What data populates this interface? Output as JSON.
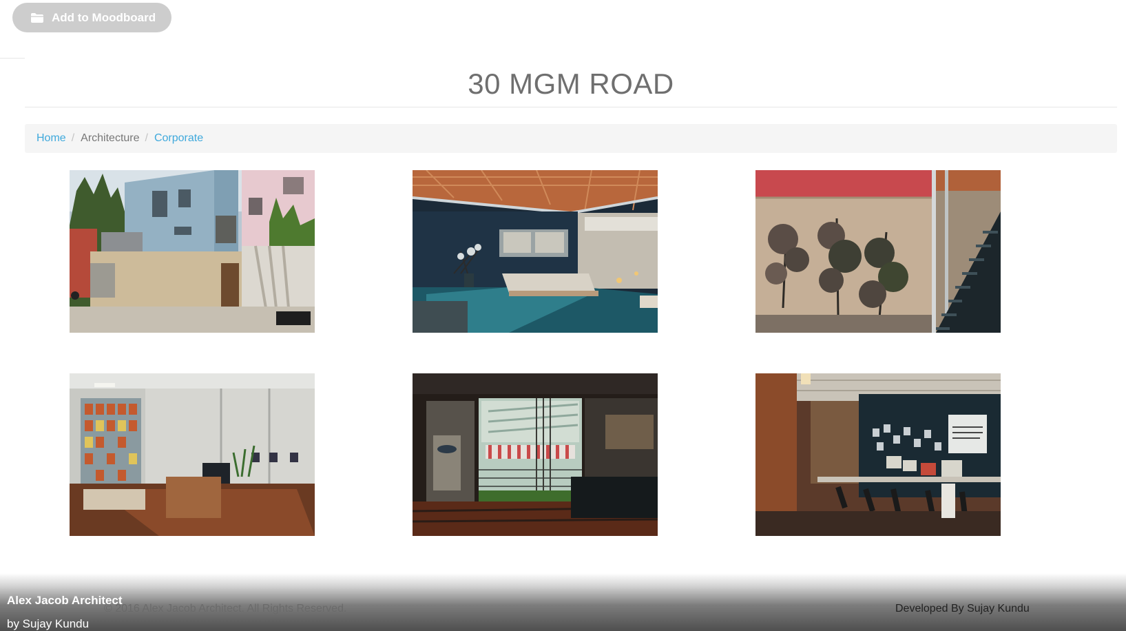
{
  "toolbar": {
    "moodboard_label": "Add to Moodboard",
    "moodboard_icon": "folder-icon"
  },
  "page": {
    "title": "30 MGM ROAD"
  },
  "breadcrumb": {
    "items": [
      {
        "label": "Home",
        "link": true
      },
      {
        "label": "Architecture",
        "link": false
      },
      {
        "label": "Corporate",
        "link": true
      }
    ],
    "separator": "/"
  },
  "gallery": {
    "images": [
      {
        "name": "building-exterior-photo"
      },
      {
        "name": "lounge-interior-photo"
      },
      {
        "name": "stair-plant-wall-photo"
      },
      {
        "name": "office-desk-photo"
      },
      {
        "name": "window-view-photo"
      },
      {
        "name": "studio-workstations-photo"
      }
    ]
  },
  "footer": {
    "brand": "Alex Jacob Architect",
    "by_line": "by Sujay Kundu",
    "copyright": "© 2016 Alex Jacob Architect. All Rights Reserved.",
    "developer": "Developed By Sujay Kundu"
  },
  "colors": {
    "link": "#3fa9dc",
    "button_bg": "#cdcdcd",
    "title": "#6f6f6f"
  }
}
